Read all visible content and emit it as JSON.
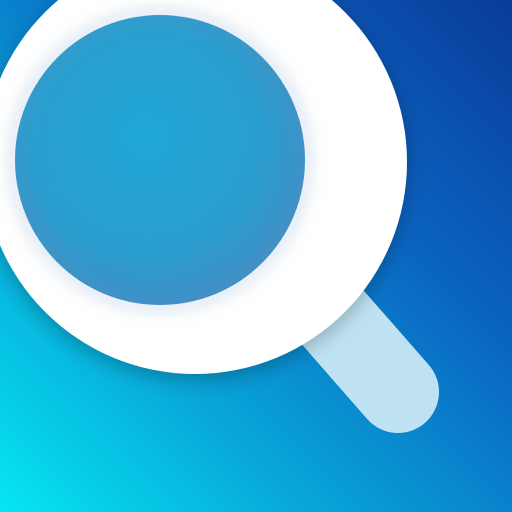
{
  "app_icon": {
    "icon": "magnifying-glass-icon",
    "colors": {
      "background_top_right": "#0a3b9a",
      "background_bottom_left": "#05e6f2",
      "ring": "#ffffff",
      "lens_center": "#2aa7d6",
      "handle": "#c7e7f4"
    }
  }
}
